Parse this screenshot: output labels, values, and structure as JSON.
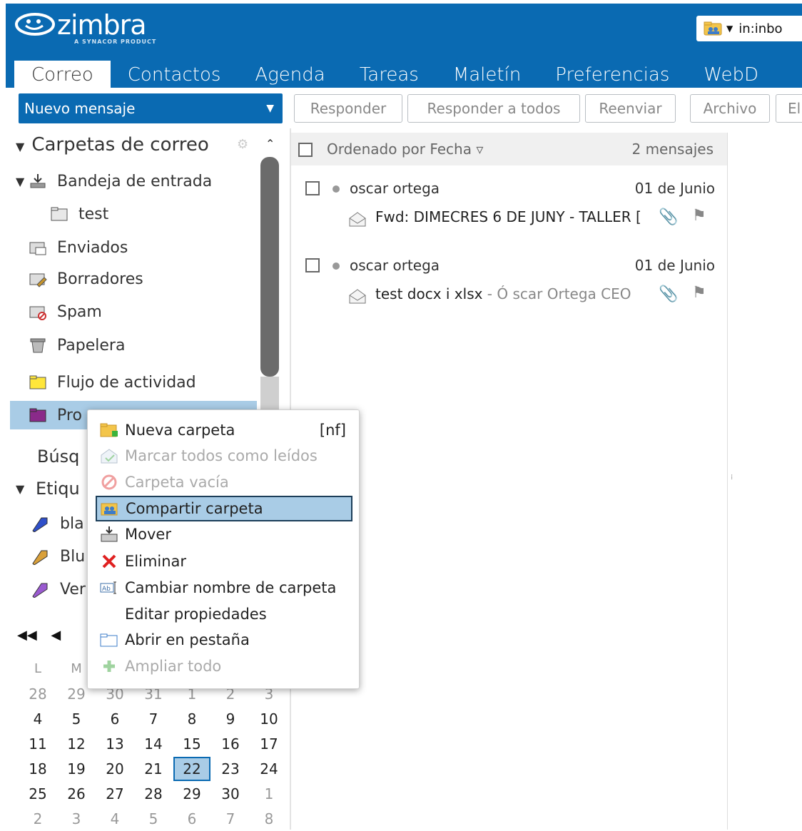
{
  "brand": {
    "name": "zimbra",
    "tagline": "A SYNACOR PRODUCT"
  },
  "search": {
    "value": "in:inbo"
  },
  "app_tabs": [
    "Correo",
    "Contactos",
    "Agenda",
    "Tareas",
    "Maletín",
    "Preferencias",
    "WebD"
  ],
  "toolbar": {
    "new_message": "Nuevo mensaje",
    "reply": "Responder",
    "reply_all": "Responder a todos",
    "forward": "Reenviar",
    "archive": "Archivo",
    "delete": "El"
  },
  "overview": {
    "mail_folders_header": "Carpetas de correo",
    "folders": {
      "inbox": "Bandeja de entrada",
      "test": "test",
      "sent": "Enviados",
      "drafts": "Borradores",
      "spam": "Spam",
      "trash": "Papelera",
      "activity": "Flujo de actividad",
      "selected": "Pro"
    },
    "searches_header": "Búsq",
    "tags_header": "Etiqu",
    "tags": [
      "bla",
      "Blu",
      "Ver"
    ]
  },
  "calendar": {
    "weekday_headers": [
      "L",
      "M"
    ],
    "weeks": [
      [
        "28",
        "29",
        "30",
        "31",
        "1",
        "2",
        "3"
      ],
      [
        "4",
        "5",
        "6",
        "7",
        "8",
        "9",
        "10"
      ],
      [
        "11",
        "12",
        "13",
        "14",
        "15",
        "16",
        "17"
      ],
      [
        "18",
        "19",
        "20",
        "21",
        "22",
        "23",
        "24"
      ],
      [
        "25",
        "26",
        "27",
        "28",
        "29",
        "30",
        "1"
      ],
      [
        "2",
        "3",
        "4",
        "5",
        "6",
        "7",
        "8"
      ]
    ],
    "today": "22"
  },
  "message_list": {
    "sort_label": "Ordenado por Fecha",
    "count": "2 mensajes",
    "messages": [
      {
        "sender": "oscar ortega",
        "date": "01 de Junio",
        "subject": "Fwd: DIMECRES 6 DE JUNY - TALLER [",
        "fragment": ""
      },
      {
        "sender": "oscar ortega",
        "date": "01 de Junio",
        "subject": "test docx i xlsx",
        "fragment": " - Ó scar Ortega CEO"
      }
    ]
  },
  "context_menu": {
    "new_folder": "Nueva carpeta",
    "new_folder_shortcut": "[nf]",
    "mark_all_read": "Marcar todos como leídos",
    "empty_folder": "Carpeta vacía",
    "share_folder": "Compartir carpeta",
    "move": "Mover",
    "delete": "Eliminar",
    "rename": "Cambiar nombre de carpeta",
    "edit_properties": "Editar propiedades",
    "open_in_tab": "Abrir en pestaña",
    "expand_all": "Ampliar todo"
  },
  "colors": {
    "brand_blue": "#0a6ab2",
    "selection": "#a9cce6",
    "menu_highlight_border": "#1c3e59"
  }
}
